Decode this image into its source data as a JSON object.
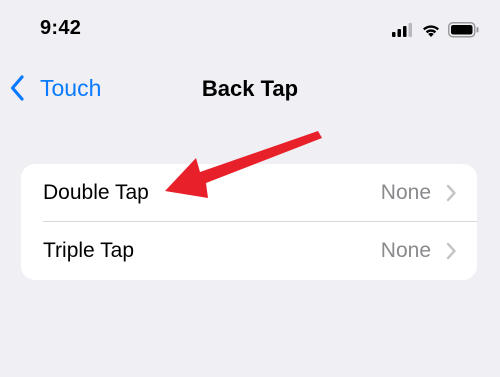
{
  "status_bar": {
    "time": "9:42",
    "icons": [
      "cellular-signal-icon",
      "wifi-icon",
      "battery-icon"
    ]
  },
  "nav": {
    "back_label": "Touch",
    "title": "Back Tap"
  },
  "rows": [
    {
      "label": "Double Tap",
      "value": "None"
    },
    {
      "label": "Triple Tap",
      "value": "None"
    }
  ],
  "colors": {
    "background": "#f0eff4",
    "accent": "#0a7aff",
    "secondary_text": "#8a8a8e",
    "annotation_arrow": "#e8202a"
  }
}
